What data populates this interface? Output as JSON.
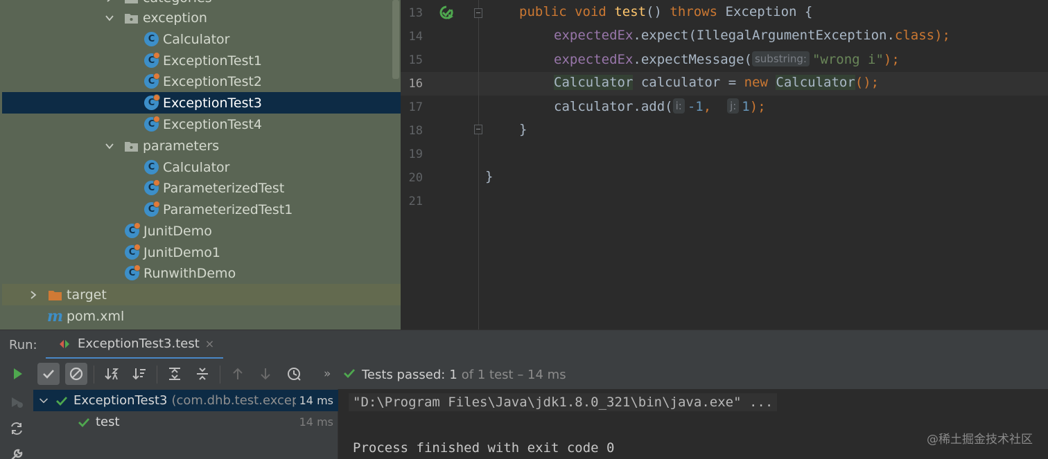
{
  "project_tree": {
    "folder_categories": "categories",
    "folder_exception": "exception",
    "exception_items": [
      "Calculator",
      "ExceptionTest1",
      "ExceptionTest2",
      "ExceptionTest3",
      "ExceptionTest4"
    ],
    "folder_parameters": "parameters",
    "parameters_items": [
      "Calculator",
      "ParameterizedTest",
      "ParameterizedTest1"
    ],
    "root_items": [
      "JunitDemo",
      "JunitDemo1",
      "RunwithDemo"
    ],
    "target": "target",
    "pom": "pom.xml",
    "selected_item": "ExceptionTest3"
  },
  "editor": {
    "line_numbers": [
      "13",
      "14",
      "15",
      "16",
      "17",
      "18",
      "19",
      "20",
      "21"
    ],
    "current_line": "16",
    "l13": {
      "public": "public",
      "void": "void",
      "name": "test",
      "parens": "()",
      "throws": "throws",
      "exception": "Exception",
      "brace": "{"
    },
    "l14": {
      "field": "expectedEx",
      "call": ".expect(",
      "type": "IllegalArgumentException",
      "dot": ".",
      "class": "class",
      "end": ");"
    },
    "l15": {
      "field": "expectedEx",
      "call": ".expectMessage(",
      "hint": "substring:",
      "string": "\"wrong i\"",
      "end": ");"
    },
    "l16": {
      "type": "Calculator",
      "var": "calculator",
      "eq": "=",
      "new": "new",
      "ctor": "Calculator",
      "end": "();"
    },
    "l17": {
      "call": "calculator.add(",
      "hint_i": "i:",
      "arg_i": "-1",
      "comma": ",",
      "hint_j": "j:",
      "arg_j": "1",
      "end": ");"
    },
    "l18": "}",
    "l20": "}"
  },
  "run_panel": {
    "label": "Run:",
    "tab_label": "ExceptionTest3.test",
    "tab_close": "×",
    "more": "»",
    "status_prefix": "Tests passed:",
    "status_count": "1",
    "status_suffix": "of 1 test – 14 ms",
    "tree": [
      {
        "name": "ExceptionTest3",
        "pkg": "(com.dhb.test.except",
        "time": "14 ms"
      },
      {
        "name": "test",
        "time": "14 ms"
      }
    ],
    "console_cmd": "\"D:\\Program Files\\Java\\jdk1.8.0_321\\bin\\java.exe\" ...",
    "console_exit": "Process finished with exit code 0"
  },
  "watermark": "@稀土掘金技术社区",
  "colors": {
    "tree_bg": "#5a6554",
    "selection": "#0d2b45",
    "keyword": "#cc7832",
    "function": "#ffc66d",
    "field": "#9876aa",
    "string": "#6a8759",
    "number": "#6897bb",
    "pass_green": "#4fa84f",
    "class_icon": "#3d8fc9"
  },
  "icons": {
    "run": "play-icon",
    "passed_filter": "check-icon",
    "ignored_filter": "circle-slash-icon",
    "sort_alpha": "sort-alpha-icon",
    "sort_duration": "sort-duration-icon",
    "expand_all": "expand-all-icon",
    "collapse_all": "collapse-all-icon",
    "prev_failed": "arrow-up-icon",
    "next_failed": "arrow-down-icon",
    "history": "history-clock-icon"
  }
}
